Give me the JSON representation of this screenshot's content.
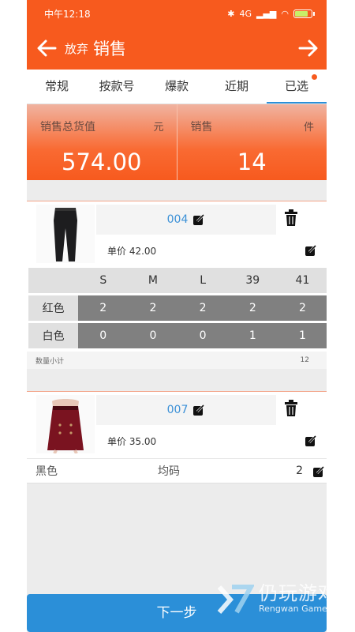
{
  "status": {
    "time": "中午12:18",
    "network": "4G"
  },
  "header": {
    "discard_label": "放弃",
    "title": "销售"
  },
  "tabs": [
    {
      "label": "常规"
    },
    {
      "label": "按款号"
    },
    {
      "label": "爆款"
    },
    {
      "label": "近期"
    },
    {
      "label": "已选",
      "active": true,
      "badge": true
    }
  ],
  "summary": {
    "total_label": "销售总货值",
    "total_unit": "元",
    "total_value": "574.00",
    "count_label": "销售",
    "count_unit": "件",
    "count_value": "14"
  },
  "products": [
    {
      "code": "004",
      "image": "black-leggings",
      "price_text": "单价 42.00",
      "sizes": [
        "S",
        "M",
        "L",
        "39",
        "41"
      ],
      "rows": [
        {
          "color": "红色",
          "values": [
            "2",
            "2",
            "2",
            "2",
            "2"
          ]
        },
        {
          "color": "白色",
          "values": [
            "0",
            "0",
            "0",
            "1",
            "1"
          ]
        }
      ],
      "subtotal_label": "数量小计",
      "subtotal_value": "12"
    },
    {
      "code": "007",
      "image": "red-leather-skirt",
      "price_text": "单价 35.00",
      "variant": {
        "color": "黑色",
        "size": "均码",
        "qty": "2"
      }
    }
  ],
  "footer": {
    "next_label": "下一步"
  },
  "watermark": {
    "cn": "仍玩游戏",
    "en": "Rengwan Games"
  },
  "colors": {
    "primary": "#f75a1e",
    "accent": "#2b8fd8",
    "cell_dark": "#808080"
  }
}
